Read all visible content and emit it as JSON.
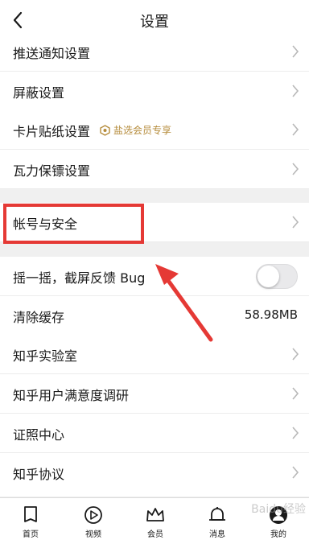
{
  "header": {
    "title": "设置"
  },
  "sections": {
    "group1": [
      {
        "label": "推送通知设置"
      },
      {
        "label": "屏蔽设置"
      },
      {
        "label": "卡片贴纸设置",
        "badge": "盐选会员专享"
      },
      {
        "label": "瓦力保镖设置"
      }
    ],
    "group2": [
      {
        "label": "帐号与安全"
      }
    ],
    "group3": [
      {
        "label": "摇一摇，截屏反馈 Bug",
        "toggle": false
      },
      {
        "label": "清除缓存",
        "value": "58.98MB"
      },
      {
        "label": "知乎实验室"
      },
      {
        "label": "知乎用户满意度调研"
      },
      {
        "label": "证照中心"
      },
      {
        "label": "知乎协议"
      }
    ]
  },
  "tabbar": [
    {
      "label": "首页",
      "icon": "home-icon"
    },
    {
      "label": "视频",
      "icon": "video-icon"
    },
    {
      "label": "会员",
      "icon": "crown-icon"
    },
    {
      "label": "消息",
      "icon": "bell-icon"
    },
    {
      "label": "我的",
      "icon": "avatar-icon"
    }
  ],
  "watermark": "Baidu经验",
  "colors": {
    "highlight": "#e53935",
    "badge": "#b58b3a",
    "separator": "#f0f0f0"
  }
}
